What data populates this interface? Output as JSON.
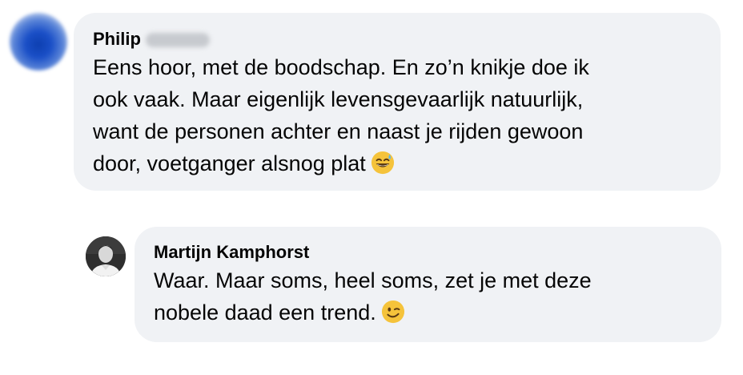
{
  "comments": [
    {
      "author_first": "Philip",
      "author_hidden": "(blurred surname)",
      "text": "Eens hoor, met de boodschap. En zo’n knikje doe ik\nook vaak. Maar eigenlijk levensgevaarlijk natuurlijk,\nwant de personen achter en naast je rijden gewoon\ndoor, voetganger alsnog plat",
      "emoji": "sweat-smile-emoji"
    },
    {
      "author": "Martijn Kamphorst",
      "text": "Waar. Maar soms, heel soms, zet je met deze\nnobele daad een trend.",
      "emoji": "wink-emoji"
    }
  ],
  "colors": {
    "bubble": "#f0f2f5",
    "text": "#050505",
    "emoji": "#f5c33b"
  }
}
